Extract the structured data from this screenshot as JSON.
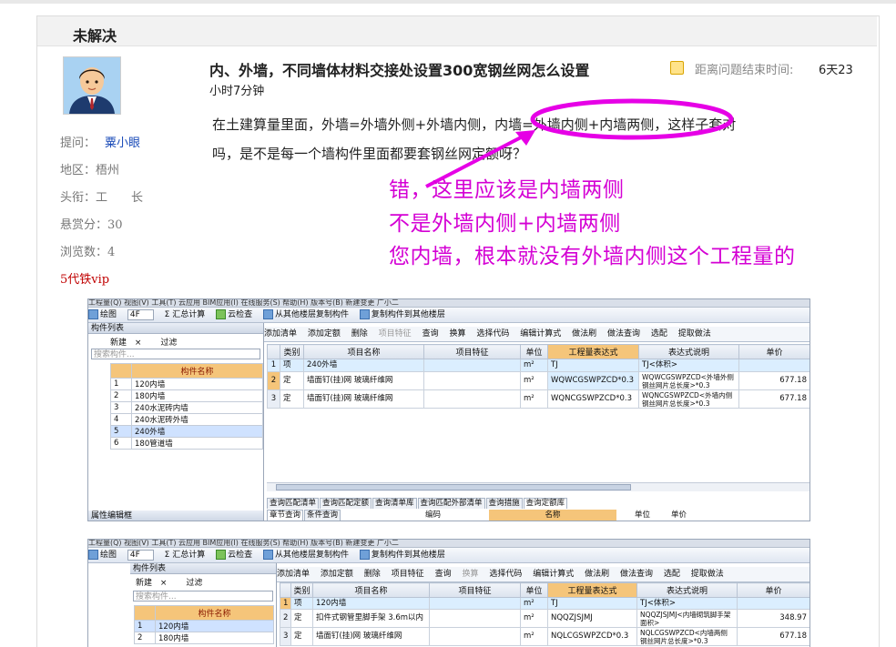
{
  "panel": {
    "title": "未解决"
  },
  "question": {
    "title": "内、外墙，不同墙体材料交接处设置300宽钢丝网怎么设置",
    "timer_label": "距离问题结束时间:",
    "timer_value": "6天23",
    "timer_rest": "小时7分钟",
    "body_line1": "在土建算量里面，外墙=外墙外侧+外墙内侧，内墙=外墙内侧+内墙两侧，这样子套对",
    "body_line2": "吗，是不是每一个墙构件里面都要套钢丝网定额呀？"
  },
  "asker": {
    "asker_label": "提问：",
    "asker_name": "粟小眼",
    "region_label": "地区：",
    "region_value": "梧州",
    "rank_label": "头衔：",
    "rank_value": "工　　长",
    "bounty_label": "悬赏分：",
    "bounty_value": "30",
    "views_label": "浏览数：",
    "views_value": "4",
    "vip": "5代铁vip"
  },
  "annotation": {
    "line1": "错，这里应该是内墙两侧",
    "line2": "不是外墙内侧+内墙两侧",
    "line3": "您内墙，根本就没有外墙内侧这个工程量的",
    "color": "#e600e6"
  },
  "shot1": {
    "menu": "工程量(Q)   视图(V)   工具(T)   云应用   BIM应用(I)   在线服务(S)   帮助(H)   版本号(B)   新建变更   广小二",
    "toolbar_left": [
      "绘图",
      "4F",
      "Σ 汇总计算",
      "云检查",
      "从其他楼层复制构件",
      "复制构件到其他楼层"
    ],
    "sidebar_title": "构件列表",
    "sidebar_tools": [
      "新建",
      "×",
      "过滤"
    ],
    "search_placeholder": "搜索构件...",
    "col_name": "构件名称",
    "components": [
      {
        "n": "1",
        "name": "120内墙"
      },
      {
        "n": "2",
        "name": "180内墙"
      },
      {
        "n": "3",
        "name": "240水泥砖内墙"
      },
      {
        "n": "4",
        "name": "240水泥砖外墙"
      },
      {
        "n": "5",
        "name": "240外墙"
      },
      {
        "n": "6",
        "name": "180管道墙"
      }
    ],
    "attr_title": "属性编辑框",
    "main_toolbar": [
      "添加清单",
      "添加定额",
      "删除",
      "项目特征",
      "查询",
      "换算",
      "选择代码",
      "编辑计算式",
      "做法刷",
      "做法查询",
      "选配",
      "提取做法"
    ],
    "headers": [
      "类别",
      "项目名称",
      "项目特征",
      "单位",
      "工程量表达式",
      "表达式说明",
      "单价"
    ],
    "rows": [
      {
        "n": "1",
        "type": "项",
        "name": "240外墙",
        "feat": "",
        "unit": "m²",
        "expr": "TJ",
        "desc": "TJ<体积>",
        "price": ""
      },
      {
        "n": "2",
        "type": "定",
        "name": "墙面钉(挂)网 玻璃纤维网",
        "feat": "",
        "unit": "m²",
        "expr": "WQWCGSWPZCD*0.3",
        "desc": "WQWCGSWPZCD<外墙外侧钢丝网片总长度>*0.3",
        "price": "677.18"
      },
      {
        "n": "3",
        "type": "定",
        "name": "墙面钉(挂)网 玻璃纤维网",
        "feat": "",
        "unit": "m²",
        "expr": "WQNCGSWPZCD*0.3",
        "desc": "WQNCGSWPZCD<外墙内侧钢丝网片总长度>*0.3",
        "price": "677.18"
      }
    ],
    "bottom_tabs": [
      "查询匹配清单",
      "查询匹配定额",
      "查询清单库",
      "查询匹配外部清单",
      "查询措施",
      "查询定额库"
    ],
    "sub_tabs": [
      "章节查询",
      "条件查询"
    ],
    "sub_headers": [
      "编码",
      "名称",
      "单位",
      "单价"
    ]
  },
  "shot2": {
    "menu": "工程量(Q)   视图(V)   工具(T)   云应用   BIM应用(I)   在线服务(S)   帮助(H)   版本号(B)   新建变更   广小二",
    "toolbar_left": [
      "绘图",
      "4F",
      "Σ 汇总计算",
      "云检查",
      "从其他楼层复制构件",
      "复制构件到其他楼层"
    ],
    "sidebar_title": "构件列表",
    "sidebar_tools": [
      "新建",
      "×",
      "过滤"
    ],
    "search_placeholder": "搜索构件...",
    "col_name": "构件名称",
    "components": [
      {
        "n": "1",
        "name": "120内墙"
      },
      {
        "n": "2",
        "name": "180内墙"
      }
    ],
    "main_toolbar": [
      "添加清单",
      "添加定额",
      "删除",
      "项目特征",
      "查询",
      "换算",
      "选择代码",
      "编辑计算式",
      "做法刷",
      "做法查询",
      "选配",
      "提取做法"
    ],
    "headers": [
      "类别",
      "项目名称",
      "项目特征",
      "单位",
      "工程量表达式",
      "表达式说明",
      "单价"
    ],
    "rows": [
      {
        "n": "1",
        "type": "项",
        "name": "120内墙",
        "feat": "",
        "unit": "m²",
        "expr": "TJ",
        "desc": "TJ<体积>",
        "price": ""
      },
      {
        "n": "2",
        "type": "定",
        "name": "扣件式钢管里脚手架 3.6m以内",
        "feat": "",
        "unit": "m²",
        "expr": "NQQZJSJMJ",
        "desc": "NQQZJSJMJ<内墙砌筑脚手架面积>",
        "price": "348.97"
      },
      {
        "n": "3",
        "type": "定",
        "name": "墙面钉(挂)网 玻璃纤维网",
        "feat": "",
        "unit": "m²",
        "expr": "NQLCGSWPZCD*0.3",
        "desc": "NQLCGSWPZCD<内墙两侧钢丝网片总长度>*0.3",
        "price": "677.18"
      }
    ]
  }
}
